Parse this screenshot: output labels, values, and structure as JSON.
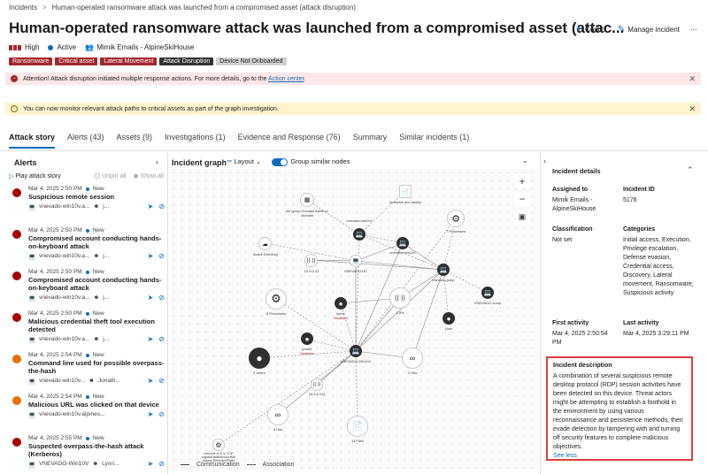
{
  "breadcrumb": [
    "Incidents",
    "Human-operated ransomware attack was launched from a compromised asset (attack disruption)"
  ],
  "title": "Human-operated ransomware attack was launched from a compromised asset (attac...",
  "header_actions": {
    "copilot": "Copilot",
    "manage": "Manage incident",
    "more": "⋯"
  },
  "meta": {
    "severity": "High",
    "status": "Active",
    "workspace": "Mimik Emails - AlpineSkiHouse"
  },
  "tags": [
    {
      "label": "Ransomware",
      "color": "#a4262c"
    },
    {
      "label": "Critical asset",
      "color": "#a4262c"
    },
    {
      "label": "Lateral Movement",
      "color": "#a4262c"
    },
    {
      "label": "Attack Disruption",
      "color": "#323130"
    },
    {
      "label": "Device Not Onboarded",
      "color": "#d1d1d1"
    }
  ],
  "banners": {
    "attention": {
      "text": "Attention! Attack disruption initiated multiple response actions. For more details, go to the",
      "link": "Action center",
      "end": "."
    },
    "info": {
      "text": "You can now monitor relevant attack paths to critical assets as part of the graph investigation."
    }
  },
  "tabs": [
    "Attack story",
    "Alerts (43)",
    "Assets (9)",
    "Investigations (1)",
    "Evidence and Response (76)",
    "Summary",
    "Similar incidents (1)"
  ],
  "alerts_panel": {
    "title": "Alerts",
    "play": "Play attack story",
    "unpin": "Unpin all",
    "show": "Show all",
    "items": [
      {
        "time": "Mar 4, 2025 2:50 PM",
        "status": "New",
        "name": "Suspicious remote session",
        "device": "vnevado-win10v.a...",
        "user": "j...",
        "color": "#a80000"
      },
      {
        "time": "Mar 4, 2025 2:50 PM",
        "status": "New",
        "name": "Compromised account conducting hands-on-keyboard attack",
        "device": "vnevado-win10v.a...",
        "user": "j...",
        "color": "#a80000"
      },
      {
        "time": "Mar 4, 2025 2:50 PM",
        "status": "New",
        "name": "Compromised account conducting hands-on-keyboard attack",
        "device": "vnevado-win10v.a...",
        "user": "j...",
        "color": "#a80000"
      },
      {
        "time": "Mar 4, 2025 2:50 PM",
        "status": "New",
        "name": "Malicious credential theft tool execution detected",
        "device": "vnevado-win10v.a...",
        "user": "j...",
        "color": "#a80000"
      },
      {
        "time": "Mar 4, 2025 2:54 PM",
        "status": "New",
        "name": "Command line used for possible overpass-the-hash",
        "device": "vnevado-win10v...",
        "user": "Jonath...",
        "color": "#e8700a"
      },
      {
        "time": "Mar 4, 2025 2:54 PM",
        "status": "New",
        "name": "Malicious URL was clicked on that device",
        "device": "vnevado-win10v.alpines...",
        "user": "",
        "color": "#e8700a"
      },
      {
        "time": "Mar 4, 2025 2:55 PM",
        "status": "New",
        "name": "Suspected overpass-the-hash attack (Kerberos)",
        "device": "VNEVADO-Win10V",
        "user": "Lynn...",
        "color": "#a80000"
      }
    ]
  },
  "graph": {
    "title": "Incident graph",
    "layout": "Layout",
    "group": "Group similar nodes",
    "legend": {
      "comm": "Communication",
      "assoc": "Association"
    },
    "labels": {
      "n1": "net group 'Domain Admin s' /domain",
      "n2": "doxiation.doc.lnk|lnk",
      "n3": "vnevado-win10v",
      "n4": "7 Processes",
      "n5": "Active Directory",
      "n6": "vnevado-win10v",
      "n7": "10.0.0.12",
      "n8": "VNEVADO-DC",
      "n9": "vnevado-jump",
      "n10": "VNEVADO-Jump",
      "n11": "8 Processes",
      "n12": "lynne",
      "n13": "Disabled",
      "n14": "2 IPs",
      "n15": "User",
      "n16": "jonme",
      "n17": "Disabled",
      "n18": "VNEVADO-Win10V",
      "n19": "2 Users",
      "n20": "2 Urls",
      "n21": "10.0.0.114",
      "n22": "4 Urls",
      "n23": "11 Files",
      "n24": "cmd.exe /d /s /c \"C:\\P rogramData\\Microsoft\\W indows Defender\\Platfo"
    }
  },
  "details": {
    "title": "Incident details",
    "assigned_label": "Assigned to",
    "assigned": "Mimik Emails - AlpineSkiHouse",
    "id_label": "Incident ID",
    "id": "5176",
    "class_label": "Classification",
    "class": "Not set",
    "cat_label": "Categories",
    "categories": "Initial access, Execution, Privilege escalation, Defense evasion, Credential access, Discovery, Lateral movement, Ransomware, Suspicious activity",
    "first_label": "First activity",
    "first": "Mar 4, 2025 2:50:54 PM",
    "last_label": "Last activity",
    "last": "Mar 4, 2025 3:29:11 PM",
    "desc_label": "Incident description",
    "desc": "A combination of several suspicious remote desktop protocol (RDP) session activities have been detected on this device. Threat actors might be attempting to establish a foothold in the environment by using various reconnaissance and persistence methods, then evade detection by tampering with and turning off security features to complete malicious objectives.",
    "see_less": "See less"
  }
}
